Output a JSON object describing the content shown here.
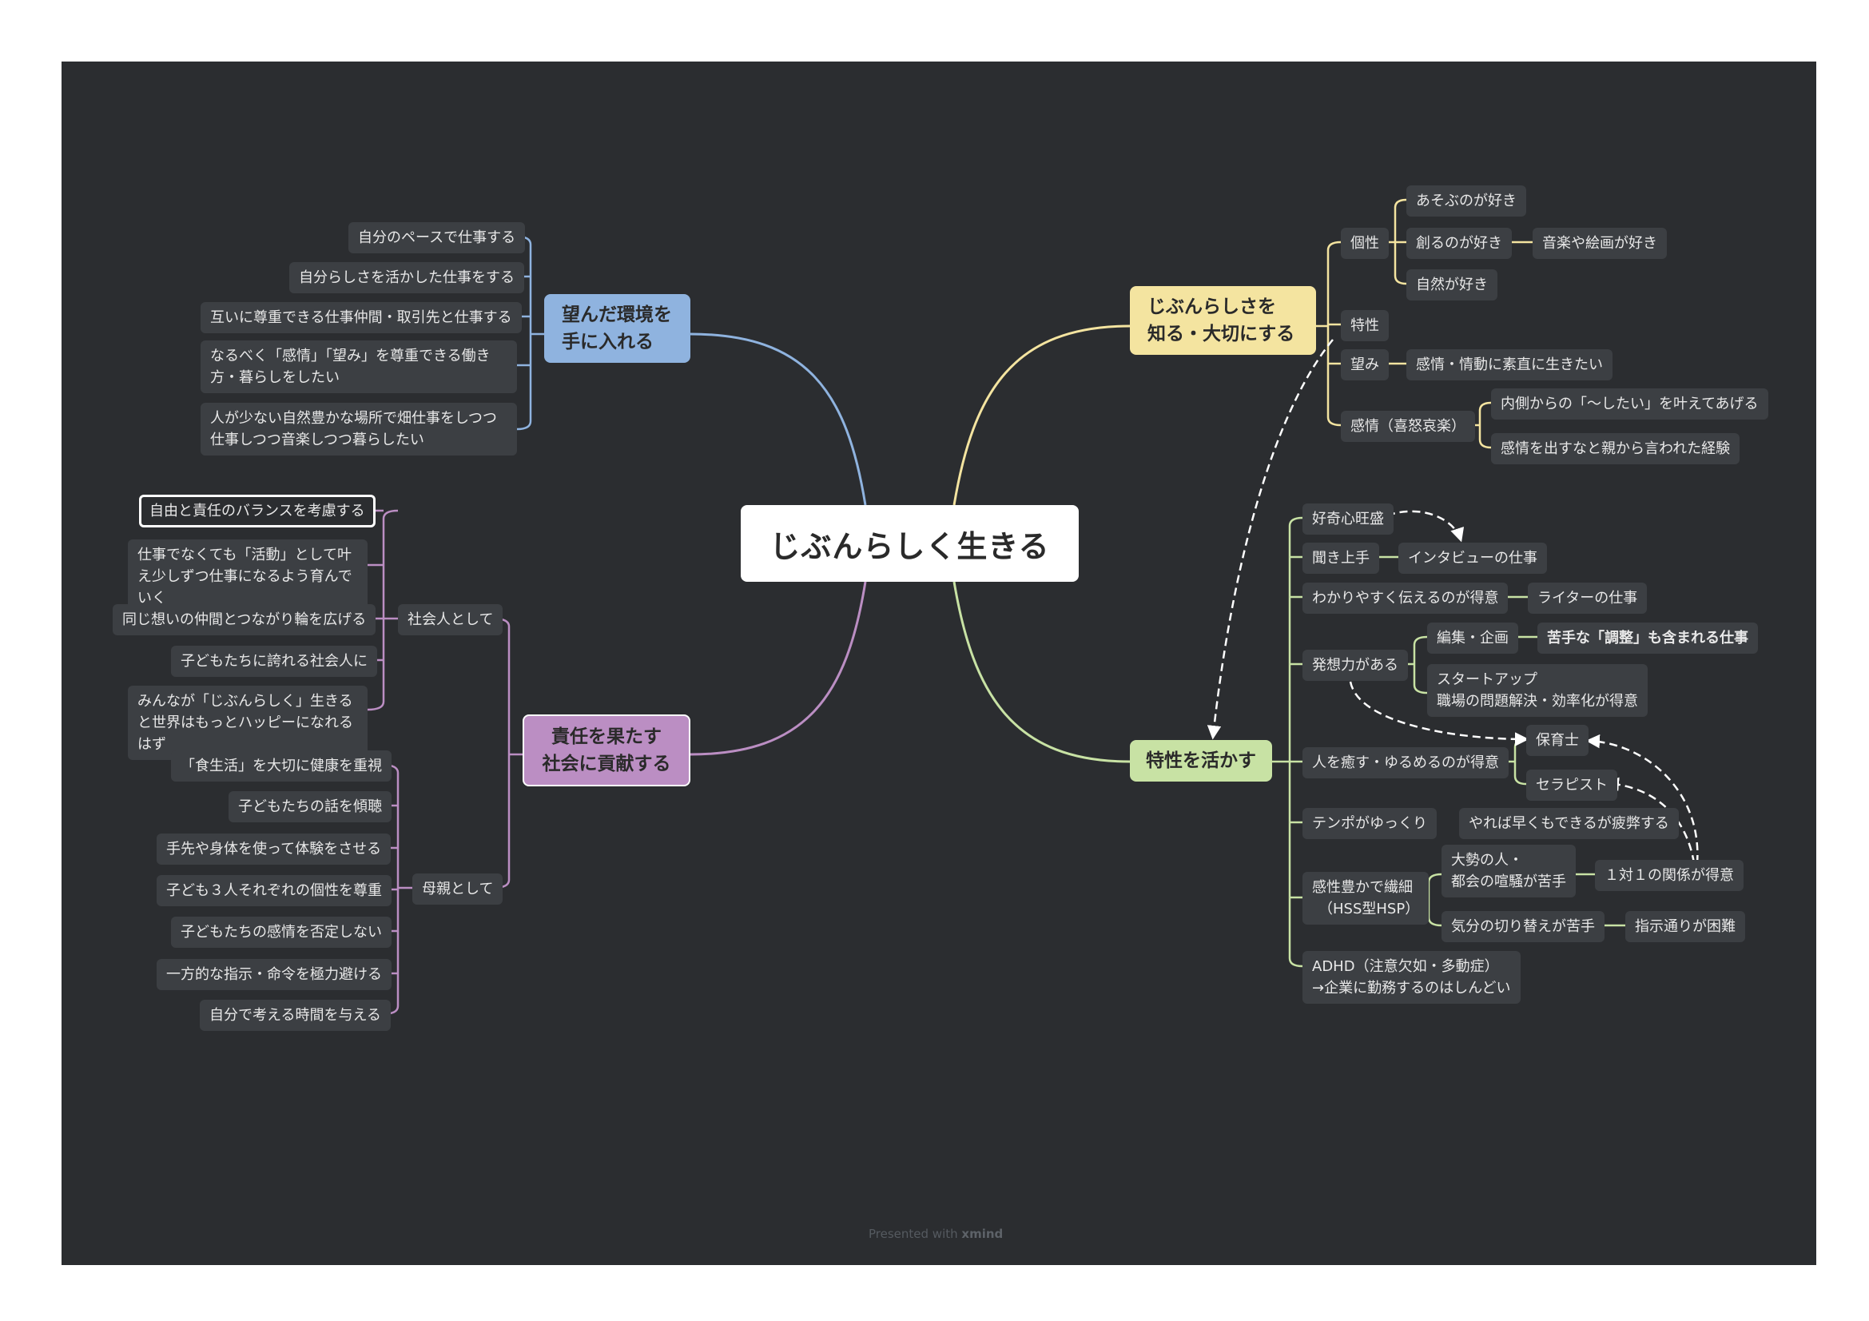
{
  "root": {
    "label": "じぶんらしく生きる"
  },
  "branches": {
    "environment": {
      "label_line1": "望んだ環境を",
      "label_line2": "手に入れる",
      "color": "#8fb3df",
      "children": [
        "自分のペースで仕事する",
        "自分らしさを活かした仕事をする",
        "互いに尊重できる仕事仲間・取引先と仕事する",
        "なるべく「感情」「望み」を尊重できる働き方・暮らしをしたい",
        "人が少ない自然豊かな場所で畑仕事をしつつ仕事しつつ音楽しつつ暮らしたい"
      ]
    },
    "responsibility": {
      "label_line1": "責任を果たす",
      "label_line2": "社会に貢献する",
      "color": "#bb8ec3",
      "society": {
        "label": "社会人として",
        "children": [
          "自由と責任のバランスを考慮する",
          "仕事でなくても「活動」として叶え少しずつ仕事になるよう育んでいく",
          "同じ想いの仲間とつながり輪を広げる",
          "子どもたちに誇れる社会人に",
          "みんなが「じぶんらしく」生きると世界はもっとハッピーになれるはず"
        ]
      },
      "mother": {
        "label": "母親として",
        "children": [
          "「食生活」を大切に健康を重視",
          "子どもたちの話を傾聴",
          "手先や身体を使って体験をさせる",
          "子ども３人それぞれの個性を尊重",
          "子どもたちの感情を否定しない",
          "一方的な指示・命令を極力避ける",
          "自分で考える時間を与える"
        ]
      }
    },
    "self": {
      "label_line1": "じぶんらしさを",
      "label_line2": "知る・大切にする",
      "color": "#f4e4a0",
      "individuality": {
        "label": "個性",
        "children": [
          "あそぶのが好き",
          "創るのが好き",
          "自然が好き"
        ],
        "sub": "音楽や絵画が好き"
      },
      "trait": {
        "label": "特性"
      },
      "wish": {
        "label": "望み",
        "child": "感情・情動に素直に生きたい"
      },
      "emotion": {
        "label": "感情（喜怒哀楽）",
        "children": [
          "内側からの「〜したい」を叶えてあげる",
          "感情を出すなと親から言われた経験"
        ]
      }
    },
    "traits": {
      "label": "特性を活かす",
      "color": "#c8e2a4",
      "items": {
        "curiosity": "好奇心旺盛",
        "listener": "聞き上手",
        "interview": "インタビューの仕事",
        "explain": "わかりやすく伝えるのが得意",
        "writer": "ライターの仕事",
        "ideas": "発想力がある",
        "editing": "編集・企画",
        "adjust": "苦手な「調整」も含まれる仕事",
        "startup_line1": "スタートアップ",
        "startup_line2": "職場の問題解決・効率化が得意",
        "heal": "人を癒す・ゆるめるのが得意",
        "nursery": "保育士",
        "therapist": "セラピスト",
        "tempo": "テンポがゆっくり",
        "tired": "やれば早くもできるが疲弊する",
        "sensitive_line1": "感性豊かで繊細",
        "sensitive_line2": "（HSS型HSP）",
        "crowd_line1": "大勢の人・",
        "crowd_line2": "都会の喧騒が苦手",
        "one_on_one": "１対１の関係が得意",
        "switch": "気分の切り替えが苦手",
        "instructions": "指示通りが困難",
        "adhd_line1": "ADHD（注意欠如・多動症）",
        "adhd_line2": "→企業に勤務するのはしんどい"
      }
    }
  },
  "footer": {
    "prefix": "Presented with",
    "brand": "xmind"
  }
}
